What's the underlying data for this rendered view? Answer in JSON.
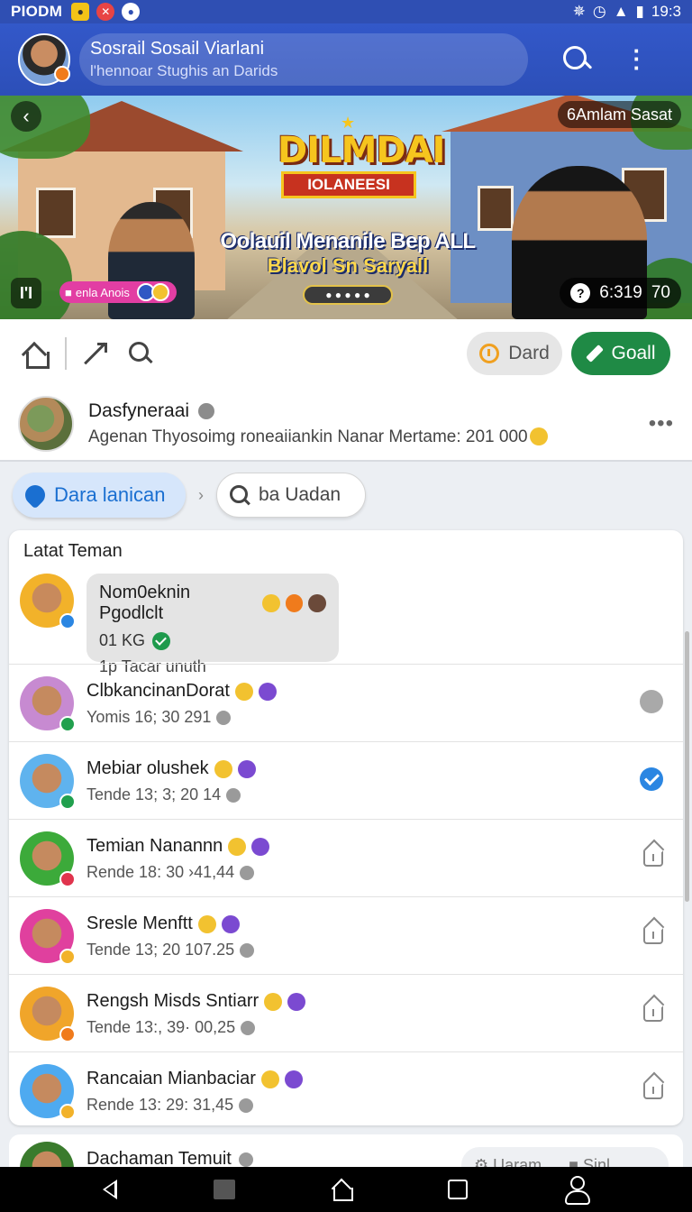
{
  "status_bar": {
    "carrier": "PIODM",
    "time": "19:3"
  },
  "app_bar": {
    "title": "Sosrail Sosail Viarlani",
    "subtitle": "l'hennoar Stughis an Darids"
  },
  "banner": {
    "top_right_chip": "6Amlam Sasat",
    "logo_line1": "DILMDAI",
    "logo_line2": "IOLANEESI",
    "headline": "Oolauil Menanile Bep ALL",
    "headline2": "Blavol Sn Saryall",
    "bottom_left_icon_text": "I'I",
    "tag_label": "enla Anois",
    "timer": "6:319",
    "timer_extra": "7",
    "timer_count": "0",
    "timer_badge": "?"
  },
  "toolbar": {
    "dard_label": "Dard",
    "goal_label": "Goall"
  },
  "profile": {
    "name": "Dasfyneraai",
    "subtitle": "Agenan Thyosoimg roneaiiankin Nanar Mertame: 201 000"
  },
  "filters": {
    "primary_chip": "Dara lanican",
    "search_placeholder": "ba Uadan"
  },
  "list": {
    "heading": "Latat Teman",
    "featured": {
      "name": "Nom0eknin Pgodlclt",
      "weight": "01 KG",
      "time": "1p Tacar unuth",
      "avatar_color": "#f2b22a"
    },
    "rows": [
      {
        "name": "ClbkancinanDorat",
        "detail": "Yomis 16; 30 291",
        "status": "grey",
        "avatar_color": "#c78ad1",
        "badge_color": "#21a04e"
      },
      {
        "name": "Mebiar olushek",
        "detail": "Tende 13; 3; 20 14",
        "status": "checked",
        "avatar_color": "#5fb3ee",
        "badge_color": "#21a04e"
      },
      {
        "name": "Temian Nanannn",
        "detail": "Rende 18: 30 ›41,44",
        "status": "house",
        "avatar_color": "#3caa3a",
        "badge_color": "#e0344d"
      },
      {
        "name": "Sresle Menftt",
        "detail": "Tende 13; 20 107.25",
        "status": "house",
        "avatar_color": "#e0409e",
        "badge_color": "#f2b22a"
      },
      {
        "name": "Rengsh Misds Sntiarr",
        "detail": "Tende 13:, 39· 00,25",
        "status": "house",
        "avatar_color": "#f0a52a",
        "badge_color": "#f07b1c"
      },
      {
        "name": "Rancaian Mianbaciar",
        "detail": "Rende 13: 29: 31,45",
        "status": "house",
        "avatar_color": "#4eaaf0",
        "badge_color": "#f2b22a"
      }
    ]
  },
  "peek": {
    "name": "Dachaman Temuit",
    "chip_label": "Uaram",
    "chip_label2": "Sinl"
  }
}
